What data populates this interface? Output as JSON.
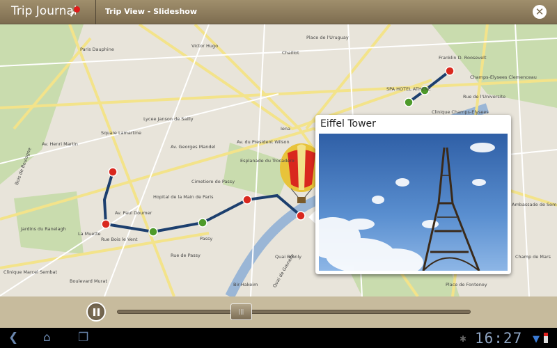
{
  "header": {
    "app_title": "Trip Journal",
    "view_title": "Trip View - Slideshow",
    "close_icon": "close-icon",
    "pin_color": "#e01b1b"
  },
  "map": {
    "labels": [
      "Paris Dauphine",
      "Victor Hugo",
      "Chaillot",
      "Place de l'Uruguay",
      "Franklin D. Roosevelt",
      "Champs-Elysees Clemenceau",
      "SPA HOTEL ATHENE",
      "Clinique Champs-Elysees",
      "Lycee Janson de Sailly",
      "Esplanade du Trocadero",
      "Passy",
      "Cimetiere de Passy",
      "Hopital de la Main de Paris",
      "Jardins du Ranelagh",
      "La Muette",
      "Av. Paul Doumer",
      "Rue de Passy",
      "Av. Henri Martin",
      "Av. Georges Mandel",
      "Av. du President Wilson",
      "Iena",
      "Quai Branly",
      "Clinique Marcel Sembat",
      "Champ de Mars",
      "Rue de l'Universite",
      "Bir-Hakeim",
      "Ambassade de Somalie",
      "Place de Fontenoy",
      "Bois de Boulogne",
      "Rue Bois le Vent",
      "Square Lamartine",
      "Boulevard Murat",
      "Quai de Grenelle"
    ],
    "route_color": "#1c3f6e",
    "marker_colors": {
      "visited": "#4e9a2a",
      "stop": "#d9281e"
    }
  },
  "popup": {
    "title": "Eiffel Tower",
    "balloon_icon": "hot-air-balloon-icon"
  },
  "player": {
    "pause_icon": "pause-icon",
    "progress": 0.35,
    "thumb_label": "|||"
  },
  "system_bar": {
    "time": "16:27",
    "back_icon": "back-icon",
    "home_icon": "home-icon",
    "recent_icon": "recent-apps-icon",
    "debug_icon": "usb-debug-icon",
    "signal_icon": "signal-icon",
    "battery_icon": "battery-icon"
  }
}
